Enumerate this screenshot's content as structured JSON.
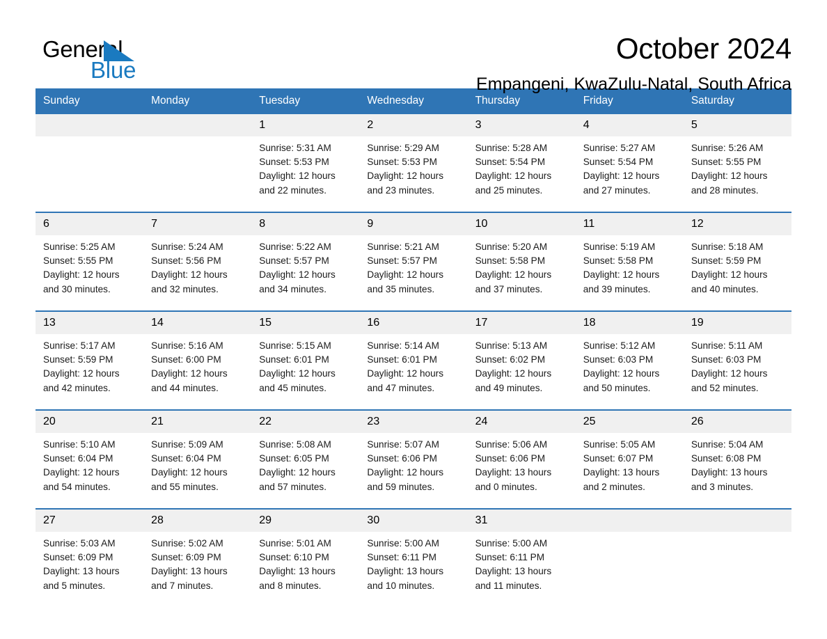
{
  "brand": {
    "name_part1": "General",
    "name_part2": "Blue",
    "triangle_color": "#1a7ac0"
  },
  "header": {
    "title": "October 2024",
    "location": "Empangeni, KwaZulu-Natal, South Africa"
  },
  "theme": {
    "header_blue": "#2f75b5",
    "daynum_band": "#f0f0f0",
    "text": "#000000"
  },
  "weekdays": [
    "Sunday",
    "Monday",
    "Tuesday",
    "Wednesday",
    "Thursday",
    "Friday",
    "Saturday"
  ],
  "weeks": [
    [
      {
        "day": "",
        "lines": [
          "",
          "",
          "",
          ""
        ]
      },
      {
        "day": "",
        "lines": [
          "",
          "",
          "",
          ""
        ]
      },
      {
        "day": "1",
        "lines": [
          "Sunrise: 5:31 AM",
          "Sunset: 5:53 PM",
          "Daylight: 12 hours",
          "and 22 minutes."
        ]
      },
      {
        "day": "2",
        "lines": [
          "Sunrise: 5:29 AM",
          "Sunset: 5:53 PM",
          "Daylight: 12 hours",
          "and 23 minutes."
        ]
      },
      {
        "day": "3",
        "lines": [
          "Sunrise: 5:28 AM",
          "Sunset: 5:54 PM",
          "Daylight: 12 hours",
          "and 25 minutes."
        ]
      },
      {
        "day": "4",
        "lines": [
          "Sunrise: 5:27 AM",
          "Sunset: 5:54 PM",
          "Daylight: 12 hours",
          "and 27 minutes."
        ]
      },
      {
        "day": "5",
        "lines": [
          "Sunrise: 5:26 AM",
          "Sunset: 5:55 PM",
          "Daylight: 12 hours",
          "and 28 minutes."
        ]
      }
    ],
    [
      {
        "day": "6",
        "lines": [
          "Sunrise: 5:25 AM",
          "Sunset: 5:55 PM",
          "Daylight: 12 hours",
          "and 30 minutes."
        ]
      },
      {
        "day": "7",
        "lines": [
          "Sunrise: 5:24 AM",
          "Sunset: 5:56 PM",
          "Daylight: 12 hours",
          "and 32 minutes."
        ]
      },
      {
        "day": "8",
        "lines": [
          "Sunrise: 5:22 AM",
          "Sunset: 5:57 PM",
          "Daylight: 12 hours",
          "and 34 minutes."
        ]
      },
      {
        "day": "9",
        "lines": [
          "Sunrise: 5:21 AM",
          "Sunset: 5:57 PM",
          "Daylight: 12 hours",
          "and 35 minutes."
        ]
      },
      {
        "day": "10",
        "lines": [
          "Sunrise: 5:20 AM",
          "Sunset: 5:58 PM",
          "Daylight: 12 hours",
          "and 37 minutes."
        ]
      },
      {
        "day": "11",
        "lines": [
          "Sunrise: 5:19 AM",
          "Sunset: 5:58 PM",
          "Daylight: 12 hours",
          "and 39 minutes."
        ]
      },
      {
        "day": "12",
        "lines": [
          "Sunrise: 5:18 AM",
          "Sunset: 5:59 PM",
          "Daylight: 12 hours",
          "and 40 minutes."
        ]
      }
    ],
    [
      {
        "day": "13",
        "lines": [
          "Sunrise: 5:17 AM",
          "Sunset: 5:59 PM",
          "Daylight: 12 hours",
          "and 42 minutes."
        ]
      },
      {
        "day": "14",
        "lines": [
          "Sunrise: 5:16 AM",
          "Sunset: 6:00 PM",
          "Daylight: 12 hours",
          "and 44 minutes."
        ]
      },
      {
        "day": "15",
        "lines": [
          "Sunrise: 5:15 AM",
          "Sunset: 6:01 PM",
          "Daylight: 12 hours",
          "and 45 minutes."
        ]
      },
      {
        "day": "16",
        "lines": [
          "Sunrise: 5:14 AM",
          "Sunset: 6:01 PM",
          "Daylight: 12 hours",
          "and 47 minutes."
        ]
      },
      {
        "day": "17",
        "lines": [
          "Sunrise: 5:13 AM",
          "Sunset: 6:02 PM",
          "Daylight: 12 hours",
          "and 49 minutes."
        ]
      },
      {
        "day": "18",
        "lines": [
          "Sunrise: 5:12 AM",
          "Sunset: 6:03 PM",
          "Daylight: 12 hours",
          "and 50 minutes."
        ]
      },
      {
        "day": "19",
        "lines": [
          "Sunrise: 5:11 AM",
          "Sunset: 6:03 PM",
          "Daylight: 12 hours",
          "and 52 minutes."
        ]
      }
    ],
    [
      {
        "day": "20",
        "lines": [
          "Sunrise: 5:10 AM",
          "Sunset: 6:04 PM",
          "Daylight: 12 hours",
          "and 54 minutes."
        ]
      },
      {
        "day": "21",
        "lines": [
          "Sunrise: 5:09 AM",
          "Sunset: 6:04 PM",
          "Daylight: 12 hours",
          "and 55 minutes."
        ]
      },
      {
        "day": "22",
        "lines": [
          "Sunrise: 5:08 AM",
          "Sunset: 6:05 PM",
          "Daylight: 12 hours",
          "and 57 minutes."
        ]
      },
      {
        "day": "23",
        "lines": [
          "Sunrise: 5:07 AM",
          "Sunset: 6:06 PM",
          "Daylight: 12 hours",
          "and 59 minutes."
        ]
      },
      {
        "day": "24",
        "lines": [
          "Sunrise: 5:06 AM",
          "Sunset: 6:06 PM",
          "Daylight: 13 hours",
          "and 0 minutes."
        ]
      },
      {
        "day": "25",
        "lines": [
          "Sunrise: 5:05 AM",
          "Sunset: 6:07 PM",
          "Daylight: 13 hours",
          "and 2 minutes."
        ]
      },
      {
        "day": "26",
        "lines": [
          "Sunrise: 5:04 AM",
          "Sunset: 6:08 PM",
          "Daylight: 13 hours",
          "and 3 minutes."
        ]
      }
    ],
    [
      {
        "day": "27",
        "lines": [
          "Sunrise: 5:03 AM",
          "Sunset: 6:09 PM",
          "Daylight: 13 hours",
          "and 5 minutes."
        ]
      },
      {
        "day": "28",
        "lines": [
          "Sunrise: 5:02 AM",
          "Sunset: 6:09 PM",
          "Daylight: 13 hours",
          "and 7 minutes."
        ]
      },
      {
        "day": "29",
        "lines": [
          "Sunrise: 5:01 AM",
          "Sunset: 6:10 PM",
          "Daylight: 13 hours",
          "and 8 minutes."
        ]
      },
      {
        "day": "30",
        "lines": [
          "Sunrise: 5:00 AM",
          "Sunset: 6:11 PM",
          "Daylight: 13 hours",
          "and 10 minutes."
        ]
      },
      {
        "day": "31",
        "lines": [
          "Sunrise: 5:00 AM",
          "Sunset: 6:11 PM",
          "Daylight: 13 hours",
          "and 11 minutes."
        ]
      },
      {
        "day": "",
        "lines": [
          "",
          "",
          "",
          ""
        ]
      },
      {
        "day": "",
        "lines": [
          "",
          "",
          "",
          ""
        ]
      }
    ]
  ]
}
